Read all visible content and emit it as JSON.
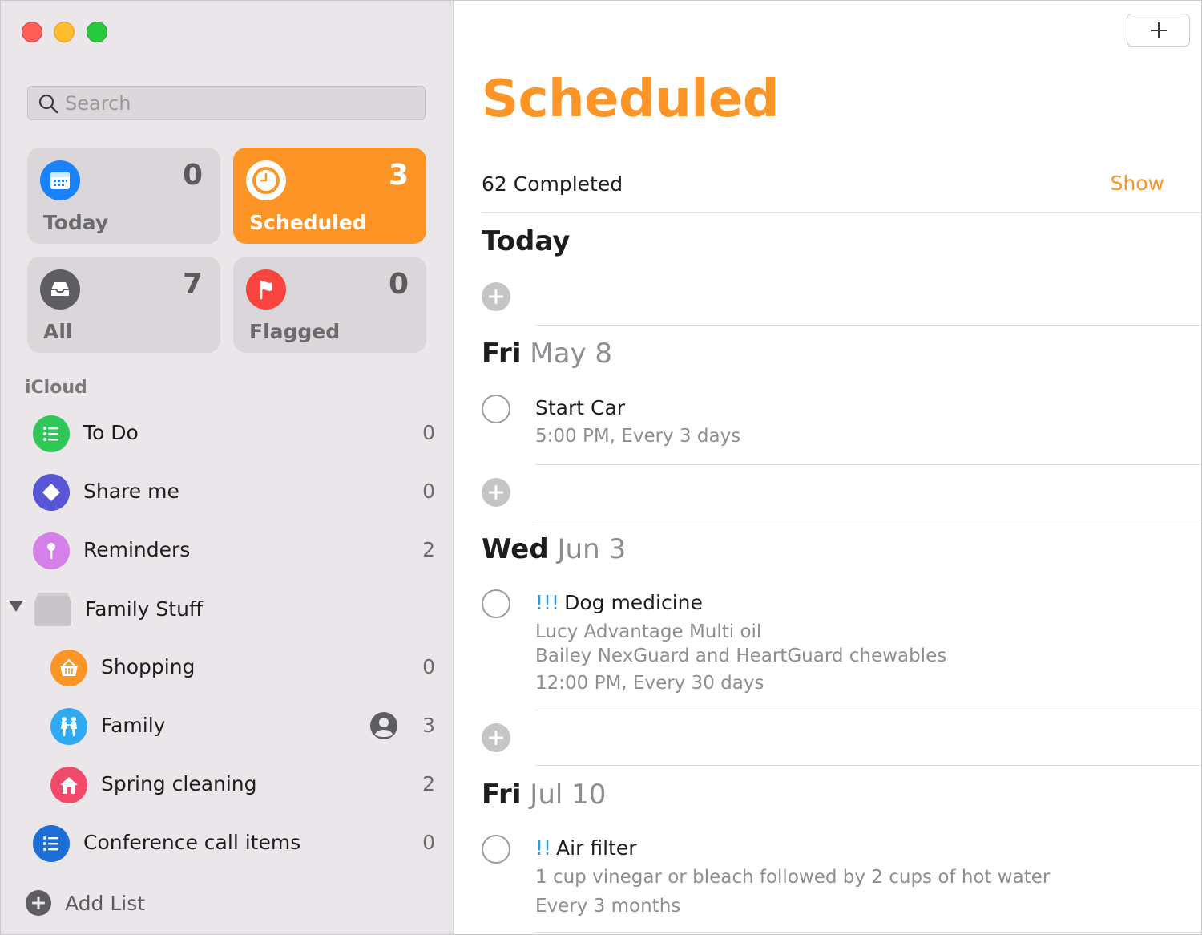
{
  "sidebar": {
    "search_placeholder": "Search",
    "tiles": {
      "today": {
        "label": "Today",
        "count": "0",
        "color": "#1a82fb"
      },
      "scheduled": {
        "label": "Scheduled",
        "count": "3",
        "color": "#fd9426"
      },
      "all": {
        "label": "All",
        "count": "7",
        "color": "#5e5e62"
      },
      "flagged": {
        "label": "Flagged",
        "count": "0",
        "color": "#f9453d"
      }
    },
    "section_label": "iCloud",
    "lists": [
      {
        "label": "To Do",
        "count": "0",
        "color": "#30c759",
        "icon": "list-bullet-icon"
      },
      {
        "label": "Share me",
        "count": "0",
        "color": "#5856d6",
        "icon": "diamond-icon"
      },
      {
        "label": "Reminders",
        "count": "2",
        "color": "#d57fe8",
        "icon": "pin-icon"
      },
      {
        "label": "Family Stuff",
        "count": "",
        "color": "#c8c4c7",
        "icon": "folder-icon"
      },
      {
        "label": "Shopping",
        "count": "0",
        "color": "#fd9426",
        "icon": "basket-icon"
      },
      {
        "label": "Family",
        "count": "3",
        "color": "#30aaf3",
        "icon": "people-icon"
      },
      {
        "label": "Spring cleaning",
        "count": "2",
        "color": "#f24a6a",
        "icon": "house-icon"
      },
      {
        "label": "Conference call items",
        "count": "0",
        "color": "#1c6fd4",
        "icon": "list-bullet-icon"
      }
    ],
    "add_list_label": "Add List"
  },
  "main": {
    "title": "Scheduled",
    "completed_text": "62 Completed",
    "show_label": "Show",
    "sections": [
      {
        "day": "Today",
        "date": ""
      },
      {
        "day": "Fri",
        "date": "May 8"
      },
      {
        "day": "Wed",
        "date": "Jun 3"
      },
      {
        "day": "Fri",
        "date": "Jul 10"
      }
    ],
    "reminders": [
      {
        "priority": "",
        "title": "Start Car",
        "notes": [
          "5:00 PM, Every 3 days"
        ]
      },
      {
        "priority": "!!!",
        "title": "Dog medicine",
        "notes": [
          "Lucy Advantage Multi oil",
          "Bailey NexGuard and HeartGuard chewables",
          "12:00 PM, Every 30 days"
        ]
      },
      {
        "priority": "!!",
        "title": "Air filter",
        "notes": [
          "1 cup vinegar or bleach followed by 2 cups of hot water",
          "Every 3 months"
        ]
      }
    ]
  }
}
